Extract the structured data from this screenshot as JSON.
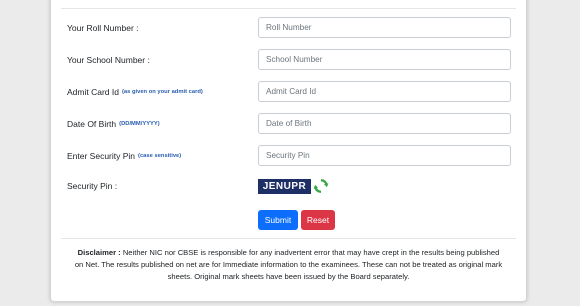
{
  "form": {
    "roll": {
      "label": "Your Roll Number :",
      "placeholder": "Roll Number"
    },
    "school": {
      "label": "Your School Number :",
      "placeholder": "School Number"
    },
    "admit": {
      "label": "Admit Card Id",
      "hint": "(as given on your admit card)",
      "placeholder": "Admit Card Id"
    },
    "dob": {
      "label": "Date Of Birth",
      "hint": "(DD/MM/YYYY)",
      "placeholder": "Date of Birth"
    },
    "pin": {
      "label": "Enter Security Pin",
      "hint": "(case sensitive)",
      "placeholder": "Security Pin"
    },
    "captcha": {
      "label": "Security Pin :",
      "code": "JENUPR"
    },
    "submit_label": "Submit",
    "reset_label": "Reset"
  },
  "disclaimer": {
    "title": "Disclaimer :",
    "text": "Neither NIC nor CBSE is responsible for any inadvertent error that may have crept in the results being published on Net. The results published on net are for Immediate information to the examinees. These can not be treated as original mark sheets. Original mark sheets have been issued by the Board separately."
  },
  "colors": {
    "primary": "#0d6efd",
    "danger": "#dc3545",
    "hint": "#2a5db0",
    "captcha_bg": "#1e2f66",
    "refresh": "#3aa64a"
  }
}
